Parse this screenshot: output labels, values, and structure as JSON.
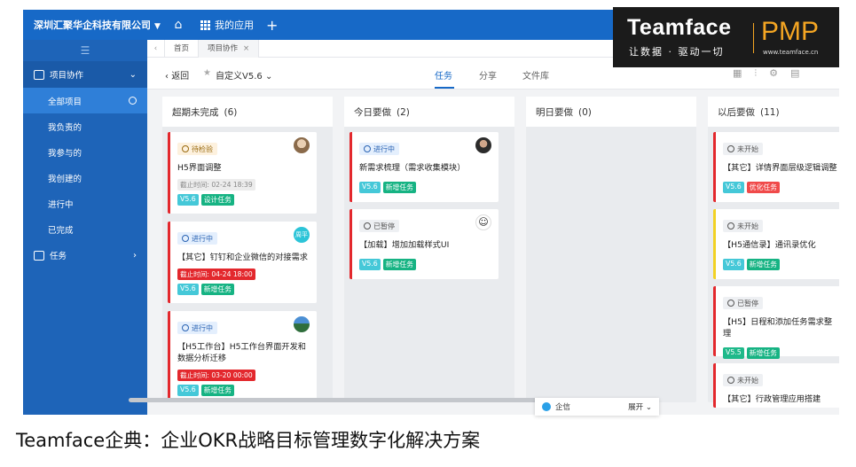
{
  "topbar": {
    "company": "深圳汇聚华企科技有限公司",
    "my_apps": "我的应用"
  },
  "sidebar": {
    "group_project": "项目协作",
    "items": [
      {
        "label": "全部项目"
      },
      {
        "label": "我负责的"
      },
      {
        "label": "我参与的"
      },
      {
        "label": "我创建的"
      },
      {
        "label": "进行中"
      },
      {
        "label": "已完成"
      }
    ],
    "group_task": "任务"
  },
  "tabs": {
    "home": "首页",
    "project": "项目协作"
  },
  "toolbar": {
    "back": "返回",
    "view": "自定义V5.6",
    "tab_task": "任务",
    "tab_share": "分享",
    "tab_files": "文件库"
  },
  "columns": [
    {
      "title": "超期未完成",
      "count": "(6)",
      "cards": [
        {
          "status": "待检验",
          "title": "H5界面调整",
          "deadline": "截止时间: 02-24 18:39",
          "tags": [
            "V5.6",
            "设计任务"
          ]
        },
        {
          "status": "进行中",
          "title": "【其它】钉钉和企业微信的对接需求",
          "deadline": "截止时间: 04-24 18:00",
          "avatar_text": "周平",
          "tags": [
            "V5.6",
            "新增任务"
          ]
        },
        {
          "status": "进行中",
          "title": "【H5工作台】H5工作台界面开发和数据分析迁移",
          "deadline": "截止时间: 03-20 00:00",
          "tags": [
            "V5.6",
            "新增任务"
          ]
        }
      ]
    },
    {
      "title": "今日要做",
      "count": "(2)",
      "cards": [
        {
          "status": "进行中",
          "title": "新需求梳理（需求收集模块）",
          "tags": [
            "V5.6",
            "新增任务"
          ]
        },
        {
          "status": "已暂停",
          "title": "【加载】增加加载样式UI",
          "tags": [
            "V5.6",
            "新增任务"
          ]
        }
      ]
    },
    {
      "title": "明日要做",
      "count": "(0)",
      "cards": []
    },
    {
      "title": "以后要做",
      "count": "(11)",
      "cards": [
        {
          "status": "未开始",
          "title": "【其它】详情界面层级逻辑调整",
          "tags": [
            "V5.6",
            "优化任务"
          ]
        },
        {
          "status": "未开始",
          "title": "【H5通信录】通讯录优化",
          "tags": [
            "V5.6",
            "新增任务"
          ]
        },
        {
          "status": "已暂停",
          "title": "【H5】日程和添加任务需求整理",
          "tags": [
            "V5.5",
            "新增任务"
          ]
        },
        {
          "status": "未开始",
          "title": "【其它】行政管理应用搭建",
          "tags": []
        }
      ]
    }
  ],
  "floatbar": {
    "label": "企信",
    "expand": "展开"
  },
  "logo": {
    "brand": "Teamface",
    "slogan": "让数据 · 驱动一切",
    "product": "PMP",
    "url": "www.teamface.cn"
  },
  "caption": "Teamface企典：企业OKR战略目标管理数字化解决方案"
}
